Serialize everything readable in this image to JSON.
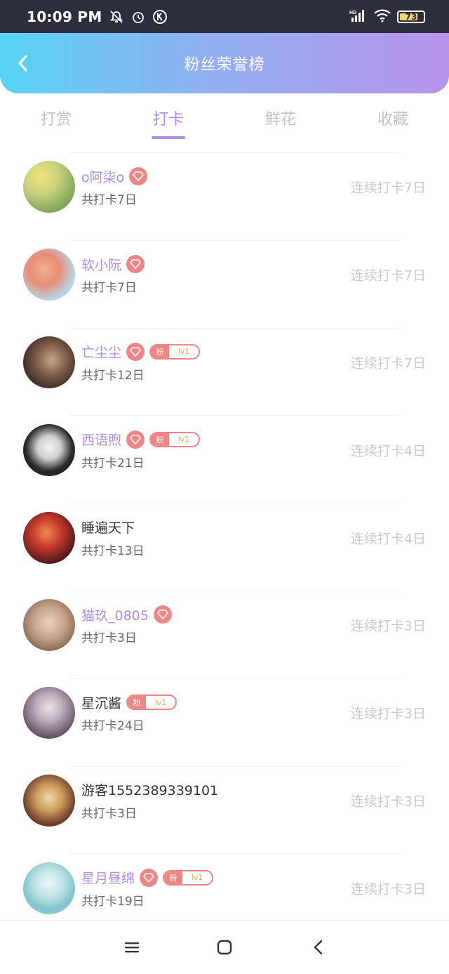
{
  "status_bar": {
    "time": "10:09 PM",
    "battery": "73",
    "icons": [
      "bell-off-icon",
      "alarm-icon",
      "k-icon",
      "hd-signal-icon",
      "wifi-icon",
      "battery-icon"
    ]
  },
  "header": {
    "title": "粉丝荣誉榜",
    "back_icon": "chevron-left-icon"
  },
  "tabs": [
    {
      "label": "打赏",
      "active": false
    },
    {
      "label": "打卡",
      "active": true
    },
    {
      "label": "鲜花",
      "active": false
    },
    {
      "label": "收藏",
      "active": false
    }
  ],
  "fan_badge": {
    "prefix": "粉",
    "level": "lv1"
  },
  "rows": [
    {
      "name": "o阿柒o",
      "vip": true,
      "fan": false,
      "total": "共打卡7日",
      "streak": "连续打卡7日"
    },
    {
      "name": "软小阮",
      "vip": true,
      "fan": false,
      "total": "共打卡7日",
      "streak": "连续打卡7日"
    },
    {
      "name": "亡尘尘",
      "vip": true,
      "fan": true,
      "total": "共打卡12日",
      "streak": "连续打卡7日"
    },
    {
      "name": "西语煦",
      "vip": true,
      "fan": true,
      "total": "共打卡21日",
      "streak": "连续打卡4日"
    },
    {
      "name": "睡遍天下",
      "vip": false,
      "fan": false,
      "total": "共打卡13日",
      "streak": "连续打卡4日"
    },
    {
      "name": "猫玖_0805",
      "vip": true,
      "fan": false,
      "total": "共打卡3日",
      "streak": "连续打卡3日"
    },
    {
      "name": "星沉酱",
      "vip": false,
      "fan": true,
      "total": "共打卡24日",
      "streak": "连续打卡3日"
    },
    {
      "name": "游客1552389339101",
      "vip": false,
      "fan": false,
      "total": "共打卡3日",
      "streak": "连续打卡3日"
    },
    {
      "name": "星月昼绵",
      "vip": true,
      "fan": true,
      "total": "共打卡19日",
      "streak": "连续打卡3日"
    }
  ],
  "colors": {
    "accent": "#b08be8",
    "header_gradient": [
      "#56d4f3",
      "#b893ea"
    ],
    "badge": "#ef8686"
  },
  "nav_bar": {
    "icons": [
      "menu-icon",
      "home-square-icon",
      "back-triangle-icon"
    ]
  }
}
